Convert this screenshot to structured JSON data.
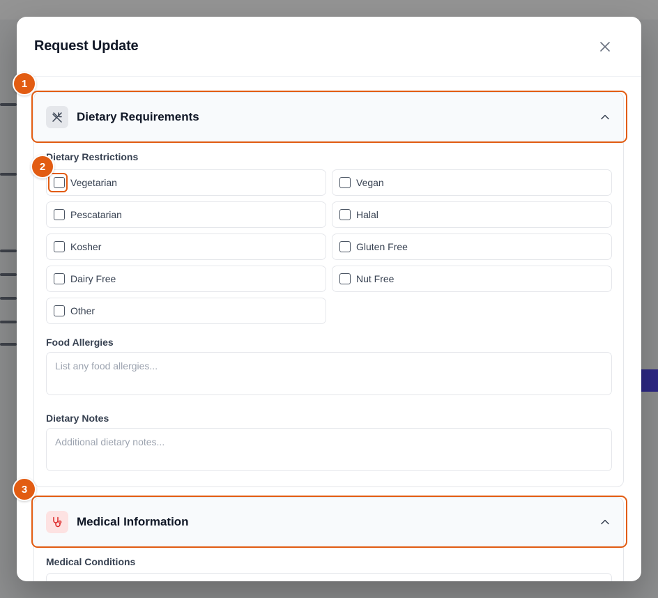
{
  "modal": {
    "title": "Request Update",
    "close_icon": "close-icon"
  },
  "dietary": {
    "title": "Dietary Requirements",
    "icon": "utensils-crossed-icon",
    "restrictions_label": "Dietary Restrictions",
    "options": [
      "Vegetarian",
      "Vegan",
      "Pescatarian",
      "Halal",
      "Kosher",
      "Gluten Free",
      "Dairy Free",
      "Nut Free",
      "Other"
    ],
    "allergies_label": "Food Allergies",
    "allergies_placeholder": "List any food allergies...",
    "notes_label": "Dietary Notes",
    "notes_placeholder": "Additional dietary notes..."
  },
  "medical": {
    "title": "Medical Information",
    "icon": "stethoscope-icon",
    "conditions_label": "Medical Conditions"
  },
  "annotations": {
    "badge1": "1",
    "badge2": "2",
    "badge3": "3"
  },
  "colors": {
    "annotation": "#e25c12",
    "medical_icon_bg": "#fde2e2",
    "medical_icon": "#dc2626"
  }
}
